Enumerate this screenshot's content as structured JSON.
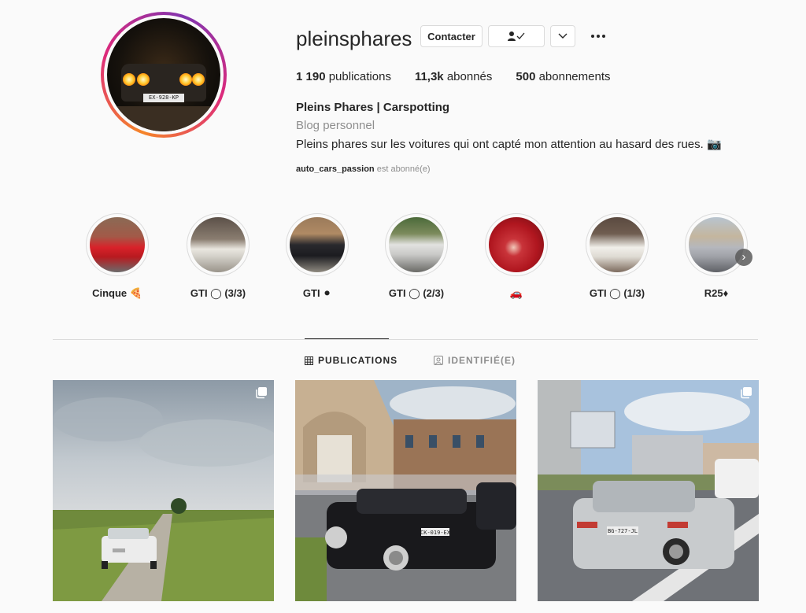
{
  "profile": {
    "username": "pleinsphares",
    "avatar_plate": "EX-928-KP",
    "buttons": {
      "contact": "Contacter",
      "follow_icon": "person-check-icon",
      "dropdown_icon": "chevron-down-icon",
      "more_icon": "more-icon"
    },
    "stats": {
      "posts_value": "1 190",
      "posts_label": "publications",
      "followers_value": "11,3k",
      "followers_label": "abonnés",
      "following_value": "500",
      "following_label": "abonnements"
    },
    "full_name": "Pleins Phares | Carspotting",
    "category": "Blog personnel",
    "bio": "Pleins phares sur les voitures qui ont capté mon attention au hasard des rues. 📷",
    "followed_by_user": "auto_cars_passion",
    "followed_by_suffix": "est abonné(e)"
  },
  "highlights": [
    {
      "label": "Cinque 🍕"
    },
    {
      "label": "GTI ◯ (3/3)"
    },
    {
      "label": "GTI ⚫"
    },
    {
      "label": "GTI ◯ (2/3)"
    },
    {
      "label": "🚗"
    },
    {
      "label": "GTI ◯ (1/3)"
    },
    {
      "label": "R25♦"
    }
  ],
  "tabs": {
    "publications": "PUBLICATIONS",
    "tagged": "IDENTIFIÉ(E)"
  },
  "posts": [
    {
      "icon": "multi-image-icon"
    },
    {
      "icon": "none",
      "plate": "CK-019-EX"
    },
    {
      "icon": "multi-image-icon",
      "plate": "BG-727-JL"
    }
  ],
  "colors": {
    "text": "#262626",
    "muted": "#8e8e8e",
    "border": "#dbdbdb",
    "background": "#fafafa"
  }
}
